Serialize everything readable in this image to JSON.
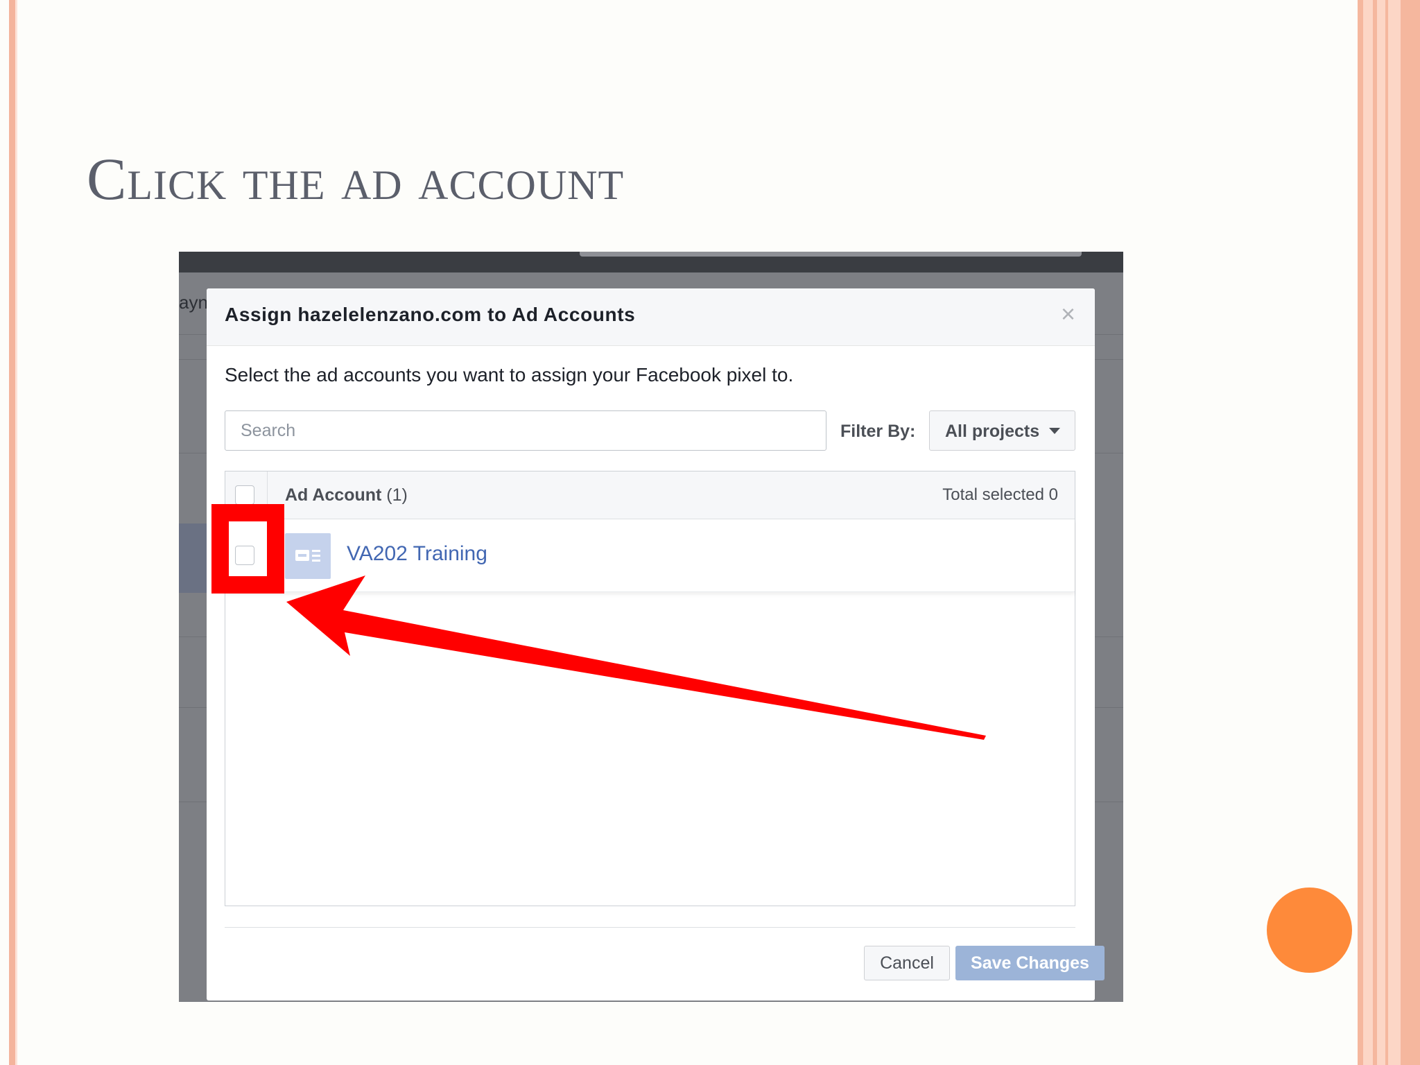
{
  "slide": {
    "title": "Click the ad account"
  },
  "background_fragment": "ayn",
  "modal": {
    "title": "Assign hazelelenzano.com to Ad Accounts",
    "close_symbol": "×",
    "instructions": "Select the ad accounts you want to assign your Facebook pixel to.",
    "search": {
      "placeholder": "Search",
      "value": ""
    },
    "filter": {
      "label": "Filter By:",
      "selected": "All projects"
    },
    "table": {
      "header_label": "Ad Account",
      "header_count": "(1)",
      "total_selected": "Total selected 0",
      "rows": [
        {
          "name": "VA202 Training",
          "checked": false,
          "icon": "ad-account-icon"
        }
      ]
    },
    "buttons": {
      "cancel": "Cancel",
      "save": "Save Changes"
    }
  },
  "colors": {
    "highlight": "#ff0000",
    "link": "#4267b2",
    "save_disabled": "#9cb4d8",
    "accent_dot": "#fe8a3a",
    "title_text": "#5b5f6b"
  },
  "icons": [
    "close-icon",
    "chevron-down-icon",
    "ad-account-icon",
    "arrow-annotation-icon"
  ]
}
